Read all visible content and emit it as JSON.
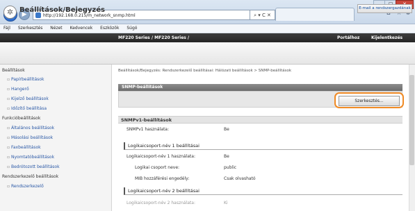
{
  "browser": {
    "url": "http://192.168.0.215/m_network_snmp.html",
    "addr_tools": "⌕ ▾ C ✕",
    "menu": [
      "Fájl",
      "Szerkesztés",
      "Nézet",
      "Kedvencek",
      "Eszközök",
      "Súgó"
    ],
    "window_buttons": {
      "min": "—",
      "max": "□",
      "close": "✕"
    },
    "icons": {
      "home": "⌂",
      "star": "☆",
      "gear": "⚙"
    }
  },
  "header": {
    "printer": "MF220 Series / MF220 Series /",
    "portal_link": "Portálhoz",
    "logout_link": "Kijelentkezés",
    "page_title": "Beállítások/Bejegyzés",
    "mail_button": "E-mail a rendszergazdának"
  },
  "sidebar": {
    "sections": [
      {
        "title": "Beállítások",
        "items": [
          "Papírbeállítások",
          "Hangerő",
          "Kijelző beállítások",
          "Időzítő beállítása"
        ]
      },
      {
        "title": "Funkcióbeállítások",
        "items": [
          "Általános beállítások",
          "Másolási beállítások",
          "Faxbeállítások",
          "Nyomtatóbeállítások",
          "Bedrótozott beállítások"
        ]
      },
      {
        "title": "Rendszerkezelő beállítások",
        "items": [
          "Rendszerkezelő"
        ]
      }
    ]
  },
  "main": {
    "breadcrumb": "Beállítások/Bejegyzés: Rendszerkezelő beállításai: Hálózati beállítások > SNMP-beállítások",
    "panel_title": "SNMP-beállítások",
    "edit_button": "Szerkesztés...",
    "snmpv1": {
      "title": "SNMPv1-beállítások",
      "label": "SNMPv1 használata:",
      "value": "Be"
    },
    "group1": {
      "title": "Logikaicsoport-név 1 beállításai",
      "rows": [
        {
          "label": "Logikaicsoport-név 1 használata:",
          "value": "Be"
        },
        {
          "label": "Logikai csoport neve:",
          "value": "public"
        },
        {
          "label": "MIB hozzáférési engedély:",
          "value": "Csak olvasható"
        }
      ]
    },
    "group2": {
      "title": "Logikaicsoport-név 2 beállításai",
      "rows": [
        {
          "label": "Logikaicsoport-név 2 használata:",
          "value": "Ki"
        }
      ]
    }
  }
}
